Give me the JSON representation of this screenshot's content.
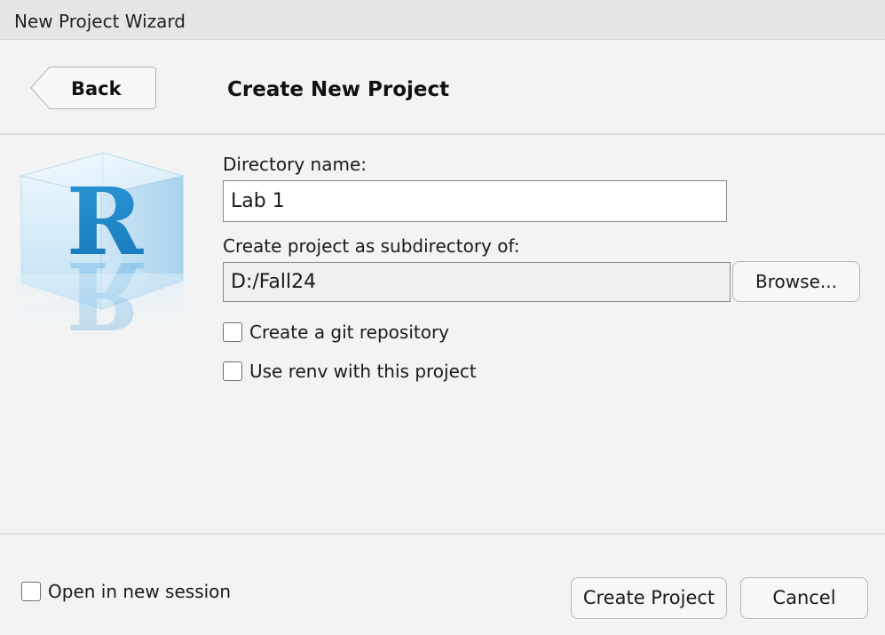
{
  "window": {
    "title": "New Project Wizard"
  },
  "header": {
    "back_label": "Back",
    "page_title": "Create New Project"
  },
  "logo": {
    "letter": "R",
    "icon": "r-cube-logo",
    "accent_color": "#1e88c7"
  },
  "form": {
    "directory_name_label": "Directory name:",
    "directory_name_value": "Lab 1",
    "subdirectory_label": "Create project as subdirectory of:",
    "subdirectory_value": "D:/Fall24",
    "browse_label": "Browse...",
    "git_repo_label": "Create a git repository",
    "git_repo_checked": false,
    "renv_label": "Use renv with this project",
    "renv_checked": false
  },
  "footer": {
    "new_session_label": "Open in new session",
    "new_session_checked": false,
    "create_label": "Create Project",
    "cancel_label": "Cancel"
  }
}
